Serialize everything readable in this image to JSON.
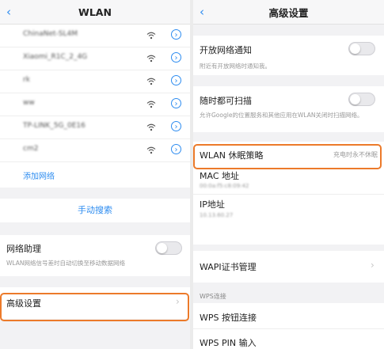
{
  "left": {
    "back_icon": "chevron-left-icon",
    "title": "WLAN",
    "networks": [
      {
        "name": "ChinaNet-SL4M"
      },
      {
        "name": "Xiaomi_R1C_2_4G"
      },
      {
        "name": "rk"
      },
      {
        "name": "ww"
      },
      {
        "name": "TP-LINK_5G_0E16"
      },
      {
        "name": "cm2"
      }
    ],
    "add_network": "添加网络",
    "manual_search": "手动搜索",
    "assistant": {
      "label": "网络助理",
      "desc": "WLAN网络信号差时自动切换至移动数据网络",
      "enabled": false
    },
    "advanced": "高级设置"
  },
  "right": {
    "back_icon": "chevron-left-icon",
    "title": "高级设置",
    "notify": {
      "label": "开放网络通知",
      "desc": "附近有开放网络时通知我。",
      "enabled": false
    },
    "scan": {
      "label": "随时都可扫描",
      "desc": "允许Google的位置服务和其他应用在WLAN关闭时扫描网络。",
      "enabled": false
    },
    "sleep": {
      "label": "WLAN 休眠策略",
      "value": "充电时永不休眠"
    },
    "mac": {
      "label": "MAC 地址",
      "value": "00:0a:f5:c8:09:42"
    },
    "ip": {
      "label": "IP地址",
      "value": "10.13.60.27"
    },
    "wapi": "WAPI证书管理",
    "wps_header": "WPS连接",
    "wps_button": "WPS 按钮连接",
    "wps_pin": "WPS PIN 输入"
  },
  "colors": {
    "accent": "#2d8cf0",
    "highlight": "#ec7a2a",
    "background": "#f2f2f4"
  }
}
